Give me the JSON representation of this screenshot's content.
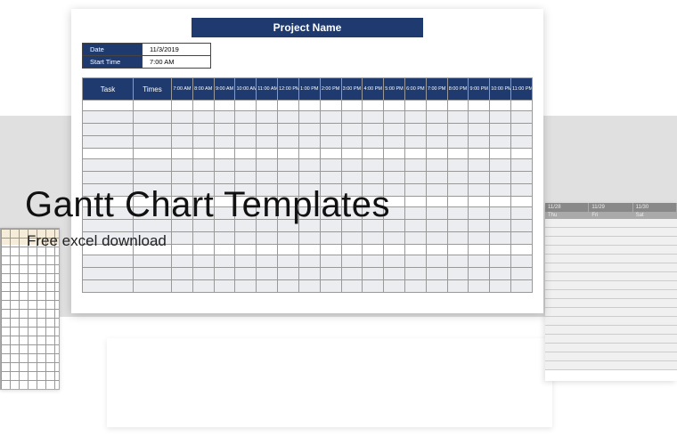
{
  "overlay": {
    "title": "Gantt Chart Templates",
    "subtitle": "Free excel download"
  },
  "sheet": {
    "title": "Project Name",
    "meta": {
      "date_label": "Date",
      "date_value": "11/3/2019",
      "start_label": "Start Time",
      "start_value": "7:00 AM"
    },
    "columns": {
      "task": "Task",
      "times": "Times",
      "hours": [
        "7:00 AM",
        "8:00 AM",
        "9:00 AM",
        "10:00 AM",
        "11:00 AM",
        "12:00 PM",
        "1:00 PM",
        "2:00 PM",
        "3:00 PM",
        "4:00 PM",
        "5:00 PM",
        "6:00 PM",
        "7:00 PM",
        "8:00 PM",
        "9:00 PM",
        "10:00 PM",
        "11:00 PM"
      ]
    }
  },
  "sched_tile": {
    "dates": [
      "11/28",
      "11/29",
      "11/30"
    ],
    "days": [
      "Thu",
      "Fri",
      "Sat"
    ]
  }
}
